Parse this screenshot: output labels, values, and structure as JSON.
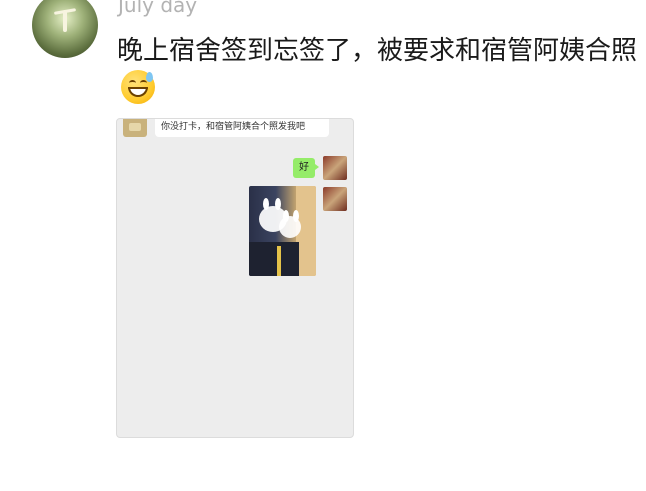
{
  "post": {
    "username": "July day",
    "text": "晚上宿舍签到忘签了，被要求和宿管阿姨合照",
    "emoji_icon": "grinning-sweat-emoji"
  },
  "chat": {
    "received_message": "你没打卡，和宿管阿姨合个照发我吧",
    "sent_message": "好",
    "bubble_color": "#95ec69",
    "background_color": "#ededed"
  }
}
